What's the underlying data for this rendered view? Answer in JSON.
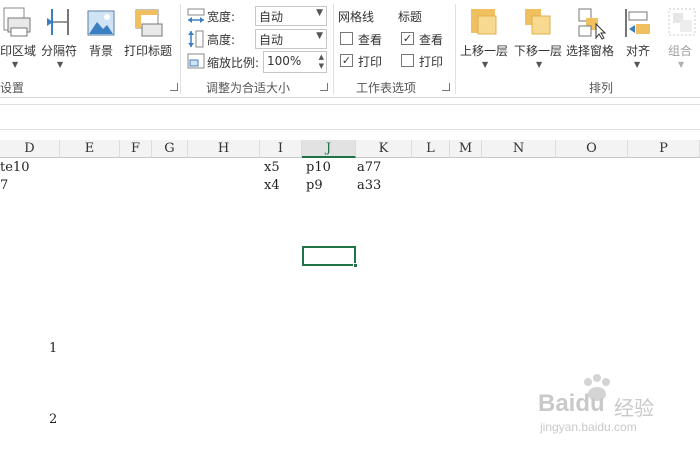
{
  "ribbon": {
    "page_setup": {
      "print_area": "印区域",
      "breaks": "分隔符",
      "background": "背景",
      "print_titles": "打印标题",
      "group_label": "设置"
    },
    "scale_to_fit": {
      "width_label": "宽度:",
      "width_value": "自动",
      "height_label": "高度:",
      "height_value": "自动",
      "scale_label": "缩放比例:",
      "scale_value": "100%",
      "group_label": "调整为合适大小"
    },
    "sheet_options": {
      "gridlines_title": "网格线",
      "headings_title": "标题",
      "view_label": "查看",
      "print_label": "打印",
      "gridlines_view": false,
      "gridlines_print": true,
      "headings_view": true,
      "headings_print": false,
      "group_label": "工作表选项"
    },
    "arrange": {
      "bring_forward": "上移一层",
      "send_backward": "下移一层",
      "selection_pane": "选择窗格",
      "align": "对齐",
      "group": "组合",
      "group_label": "排列"
    },
    "colors": {
      "shape_yellow": "#f0c060",
      "shape_yellow_light": "#f7d98f",
      "accent_blue": "#3c7fc1"
    }
  },
  "columns": [
    "D",
    "E",
    "F",
    "G",
    "H",
    "I",
    "J",
    "K",
    "L",
    "M",
    "N",
    "O",
    "P"
  ],
  "selected_column": "J",
  "cells": {
    "r1": {
      "d": "te10",
      "i": "x5",
      "j": "p10",
      "k": "a77"
    },
    "r2": {
      "d": "7",
      "i": "x4",
      "j": "p9",
      "k": "a33"
    },
    "n1": "1",
    "n2": "2"
  },
  "watermark": {
    "brand": "Baidu",
    "brand_cn": "经验",
    "url": "jingyan.baidu.com"
  }
}
